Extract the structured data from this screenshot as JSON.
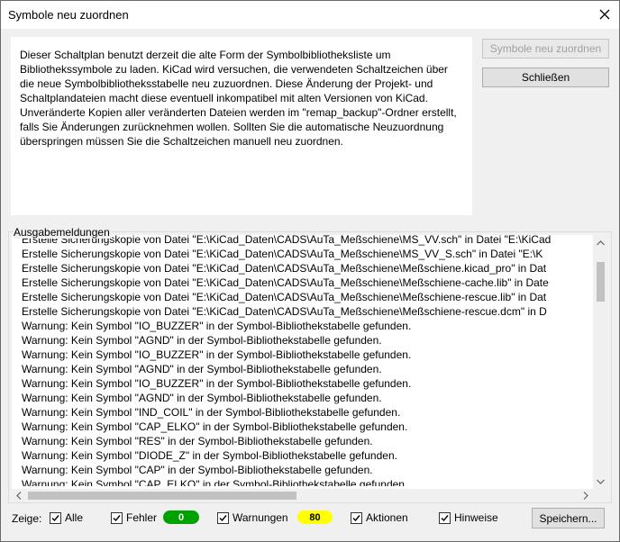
{
  "window": {
    "title": "Symbole neu zuordnen"
  },
  "info": {
    "text": "Dieser Schaltplan benutzt derzeit die alte Form der Symbolbibliotheksliste um Bibliothekssymbole zu laden. KiCad wird versuchen, die verwendeten Schaltzeichen über die neue Symbolbibliotheksstabelle neu zuzuordnen. Diese Änderung der Projekt- und Schaltplandateien macht diese eventuell inkompatibel mit alten Versionen von KiCad. Unveränderte Kopien aller veränderten Dateien werden im \"remap_backup\"-Ordner erstellt, falls Sie Änderungen zurücknehmen wollen. Sollten Sie die automatische Neuzuordnung überspringen müssen Sie die Schaltzeichen manuell neu zuordnen."
  },
  "buttons": {
    "remap": "Symbole neu zuordnen",
    "close": "Schließen",
    "save": "Speichern..."
  },
  "output": {
    "label": "Ausgabemeldungen",
    "lines": [
      "Erstelle Sicherungskopie von Datei \"E:\\KiCad_Daten\\CADS\\AuTa_Meßschiene\\MS_VV.sch\" in Datei \"E:\\KiCad",
      "Erstelle Sicherungskopie von Datei \"E:\\KiCad_Daten\\CADS\\AuTa_Meßschiene\\MS_VV_S.sch\" in Datei \"E:\\K",
      "Erstelle Sicherungskopie von Datei \"E:\\KiCad_Daten\\CADS\\AuTa_Meßschiene\\Meßschiene.kicad_pro\" in Dat",
      "Erstelle Sicherungskopie von Datei \"E:\\KiCad_Daten\\CADS\\AuTa_Meßschiene\\Meßschiene-cache.lib\" in Date",
      "Erstelle Sicherungskopie von Datei \"E:\\KiCad_Daten\\CADS\\AuTa_Meßschiene\\Meßschiene-rescue.lib\" in Dat",
      "Erstelle Sicherungskopie von Datei \"E:\\KiCad_Daten\\CADS\\AuTa_Meßschiene\\Meßschiene-rescue.dcm\" in D",
      "Warnung: Kein Symbol \"IO_BUZZER\" in der Symbol-Bibliothekstabelle gefunden.",
      "Warnung: Kein Symbol \"AGND\" in der Symbol-Bibliothekstabelle gefunden.",
      "Warnung: Kein Symbol \"IO_BUZZER\" in der Symbol-Bibliothekstabelle gefunden.",
      "Warnung: Kein Symbol \"AGND\" in der Symbol-Bibliothekstabelle gefunden.",
      "Warnung: Kein Symbol \"IO_BUZZER\" in der Symbol-Bibliothekstabelle gefunden.",
      "Warnung: Kein Symbol \"AGND\" in der Symbol-Bibliothekstabelle gefunden.",
      "Warnung: Kein Symbol \"IND_COIL\" in der Symbol-Bibliothekstabelle gefunden.",
      "Warnung: Kein Symbol \"CAP_ELKO\" in der Symbol-Bibliothekstabelle gefunden.",
      "Warnung: Kein Symbol \"RES\" in der Symbol-Bibliothekstabelle gefunden.",
      "Warnung: Kein Symbol \"DIODE_Z\" in der Symbol-Bibliothekstabelle gefunden.",
      "Warnung: Kein Symbol \"CAP\" in der Symbol-Bibliothekstabelle gefunden.",
      "Warnung: Kein Symbol \"CAP_ELKO\" in der Symbol-Bibliothekstabelle gefunden."
    ]
  },
  "filters": {
    "show_label": "Zeige:",
    "all": {
      "label": "Alle",
      "checked": true
    },
    "errors": {
      "label": "Fehler",
      "checked": true,
      "count": "0",
      "color": "#00a200"
    },
    "warnings": {
      "label": "Warnungen",
      "checked": true,
      "count": "80",
      "color": "#ffff00"
    },
    "actions": {
      "label": "Aktionen",
      "checked": true
    },
    "infos": {
      "label": "Hinweise",
      "checked": true
    }
  }
}
